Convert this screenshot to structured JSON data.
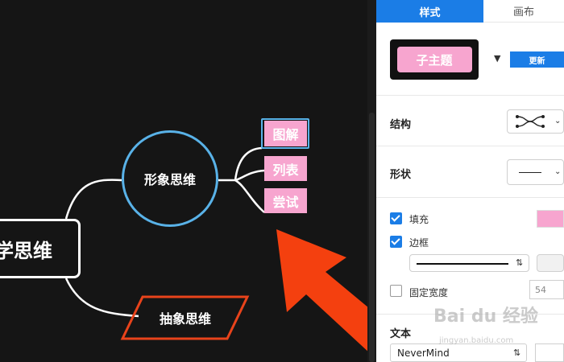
{
  "mindmap": {
    "root": "学思维",
    "circle": "形象思维",
    "parallelogram": "抽象思维",
    "leaves": [
      "图解",
      "列表",
      "尝试"
    ]
  },
  "panel": {
    "tabs": [
      "样式",
      "画布"
    ],
    "preview_label": "子主题",
    "update_button": "更新",
    "structure_label": "结构",
    "shape_label": "形状",
    "fill_label": "填充",
    "border_label": "边框",
    "fixed_width_label": "固定宽度",
    "fixed_width_value": "54",
    "text_label": "文本",
    "font_value": "NeverMind"
  },
  "watermark": {
    "brand": "Bai du 经验",
    "url": "jingyan.baidu.com"
  },
  "colors": {
    "accent_blue": "#1b7de6",
    "node_pink": "#f7a5cf",
    "circle_blue": "#59b2e8",
    "arrow_orange": "#f4400f",
    "parallelogram_border": "#e8431b"
  }
}
